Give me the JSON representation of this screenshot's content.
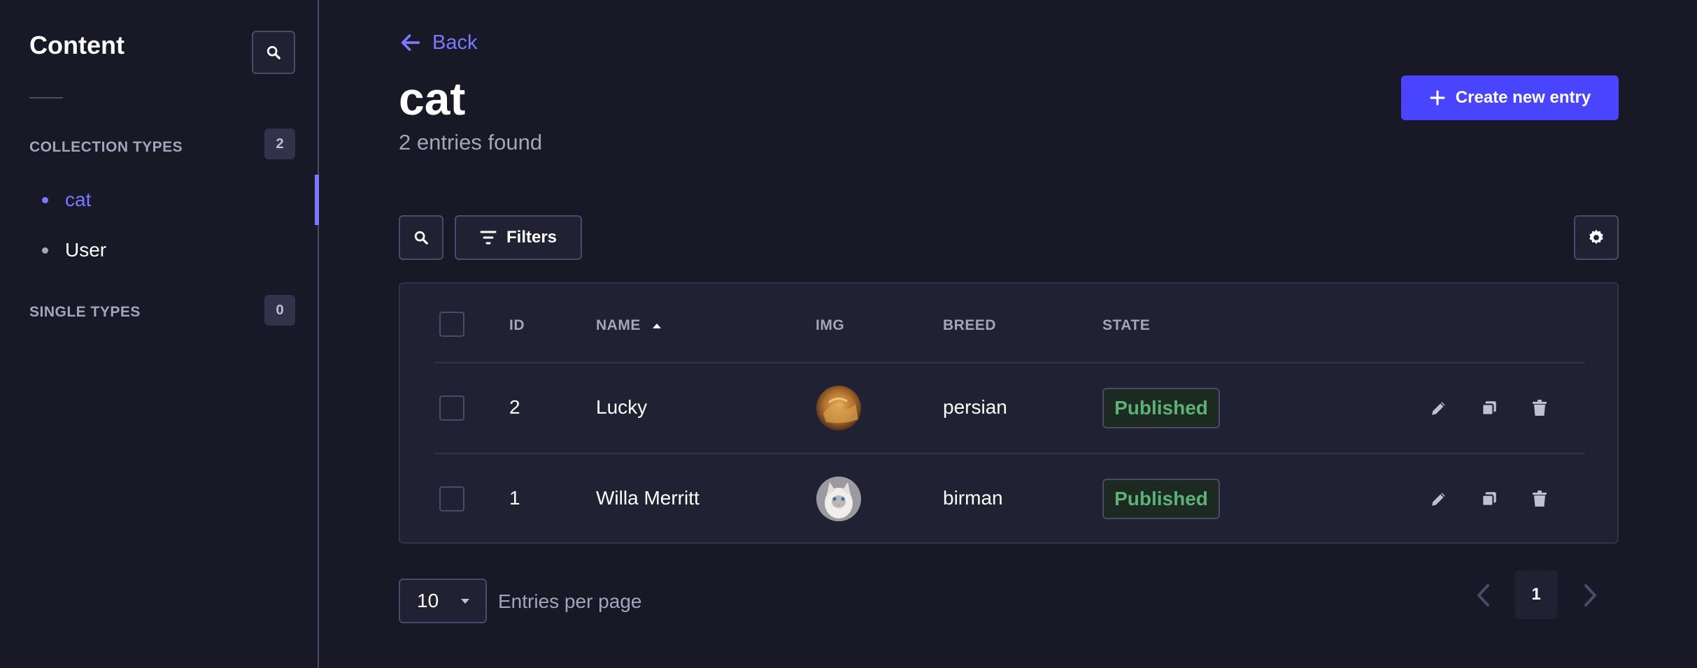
{
  "sidebar": {
    "title": "Content",
    "collection_types": {
      "label": "COLLECTION TYPES",
      "count": "2"
    },
    "items": [
      {
        "label": "cat",
        "active": true
      },
      {
        "label": "User",
        "active": false
      }
    ],
    "single_types": {
      "label": "SINGLE TYPES",
      "count": "0"
    }
  },
  "header": {
    "back_label": "Back",
    "title": "cat",
    "subtitle": "2 entries found",
    "create_label": "Create new entry"
  },
  "toolbar": {
    "filters_label": "Filters"
  },
  "table": {
    "columns": [
      "ID",
      "NAME",
      "IMG",
      "BREED",
      "STATE"
    ],
    "sort_column": "NAME",
    "rows": [
      {
        "id": "2",
        "name": "Lucky",
        "breed": "persian",
        "state": "Published",
        "img": "golden-cat-avatar"
      },
      {
        "id": "1",
        "name": "Willa Merritt",
        "breed": "birman",
        "state": "Published",
        "img": "white-cat-avatar"
      }
    ]
  },
  "pagination": {
    "per_page": "10",
    "per_page_label": "Entries per page",
    "current_page": "1"
  },
  "colors": {
    "background": "#181826",
    "surface": "#212134",
    "accent": "#7b79ff",
    "primary_button": "#4945ff",
    "published": "#5cb176"
  },
  "icons": [
    "search-icon",
    "arrow-left-icon",
    "plus-icon",
    "filter-icon",
    "gear-icon",
    "sort-up-icon",
    "pencil-icon",
    "duplicate-icon",
    "trash-icon",
    "chevron-down-icon",
    "chevron-left-icon",
    "chevron-right-icon"
  ]
}
